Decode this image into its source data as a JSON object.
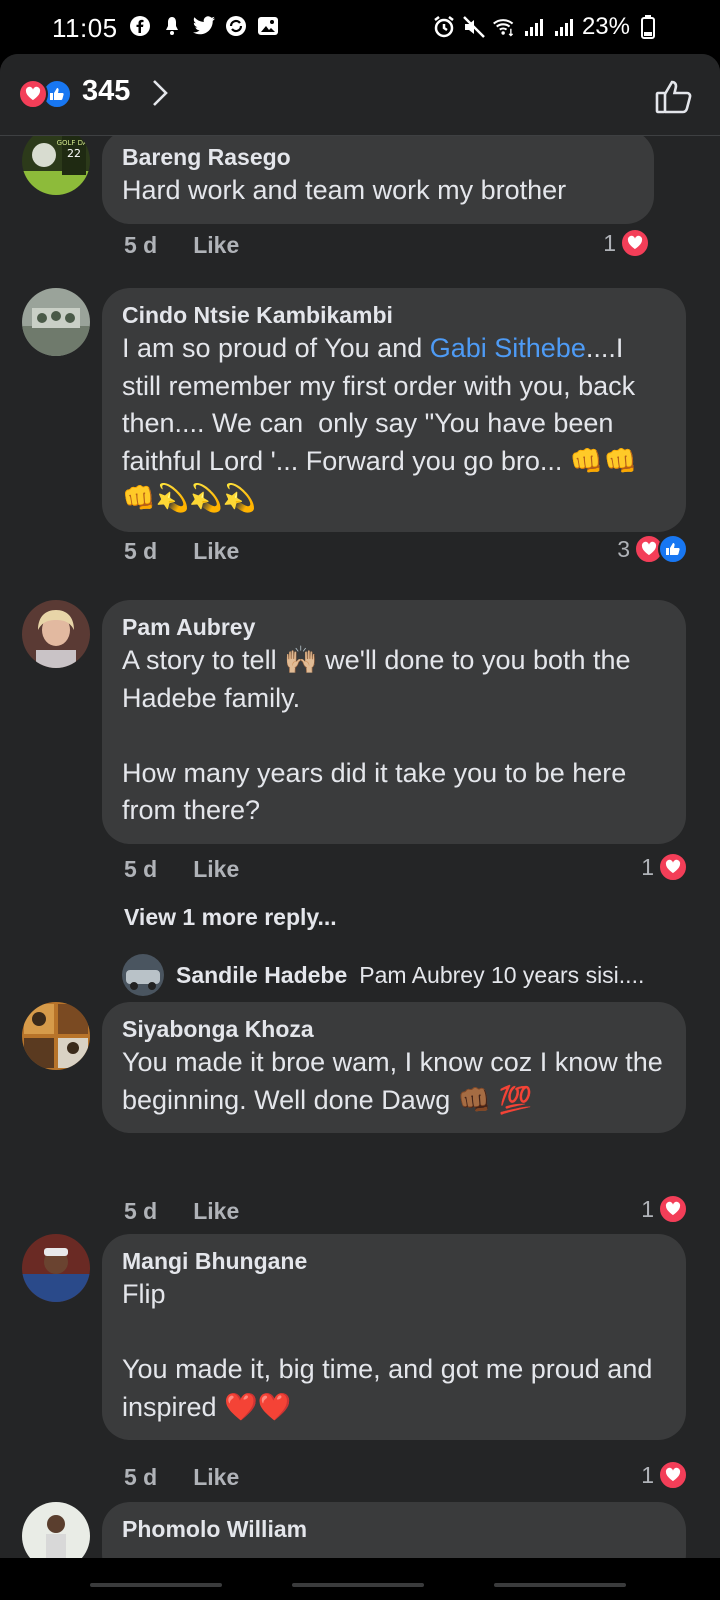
{
  "status_bar": {
    "time": "11:05",
    "battery": "23%",
    "left_icons": [
      "facebook-icon",
      "notification-icon",
      "twitter-icon",
      "app-icon",
      "gallery-icon"
    ],
    "right_icons": [
      "alarm-icon",
      "mute-icon",
      "wifi-icon",
      "signal-icon",
      "signal-icon",
      "battery-icon"
    ]
  },
  "header": {
    "reaction_count": "345"
  },
  "colors": {
    "panel": "#242526",
    "bubble": "#3a3b3c",
    "link": "#4e9bf5",
    "heart": "#f33e58",
    "like": "#1877f2"
  },
  "comments": [
    {
      "author": "Bareng Rasego",
      "text": "Hard work and team work my brother",
      "time": "5 d",
      "like_label": "Like",
      "reaction_count": "1"
    },
    {
      "author": "Cindo Ntsie Kambikambi",
      "text_before": "I am so proud of You and ",
      "link": "Gabi Sithebe",
      "text_after": "....I still remember my first order with you, back then.... We can  only say \"You have been faithful Lord '... Forward you go bro... 👊👊👊💫💫💫",
      "time": "5 d",
      "like_label": "Like",
      "reaction_count": "3"
    },
    {
      "author": "Pam Aubrey",
      "text": "A story to tell 🙌🏼 we'll done to you both the Hadebe family.\n\nHow many years did it take you to be here from there?",
      "time": "5 d",
      "like_label": "Like",
      "reaction_count": "1",
      "view_more": "View 1 more reply...",
      "reply_author": "Sandile Hadebe",
      "reply_text": "Pam Aubrey 10 years sisi...."
    },
    {
      "author": "Siyabonga Khoza",
      "text": "You made it broe wam, I know coz I know the beginning. Well done Dawg 👊🏾 💯",
      "time": "5 d",
      "like_label": "Like",
      "reaction_count": "1"
    },
    {
      "author": "Mangi Bhungane",
      "text": "Flip\n\nYou made it, big time, and got me proud and inspired ❤️❤️",
      "time": "5 d",
      "like_label": "Like",
      "reaction_count": "1"
    },
    {
      "author": "Phomolo William"
    }
  ]
}
